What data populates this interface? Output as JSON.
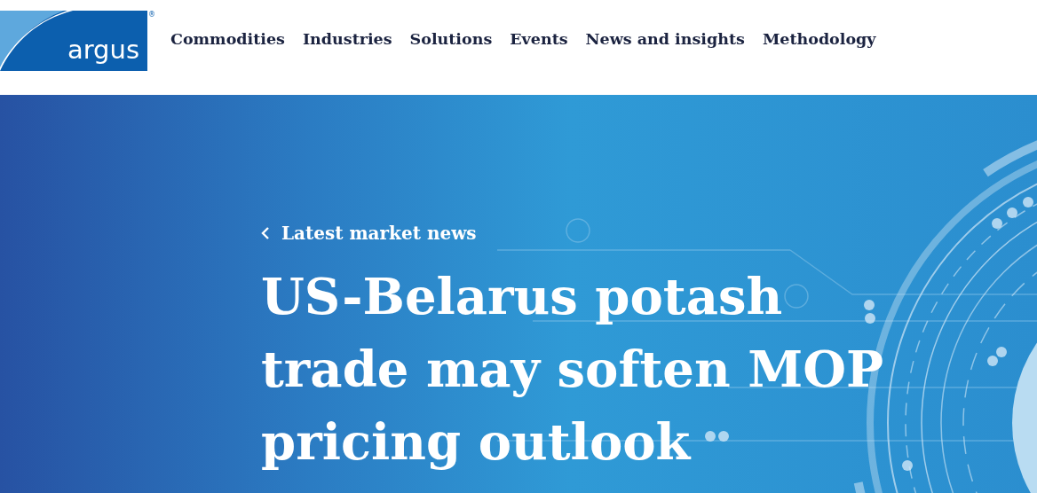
{
  "logo": {
    "text": "argus",
    "mark": "®"
  },
  "nav": [
    "Commodities",
    "Industries",
    "Solutions",
    "Events",
    "News and insights",
    "Methodology"
  ],
  "hero": {
    "back_link": "Latest market news",
    "title": "US-Belarus potash trade may soften MOP pricing outlook"
  }
}
